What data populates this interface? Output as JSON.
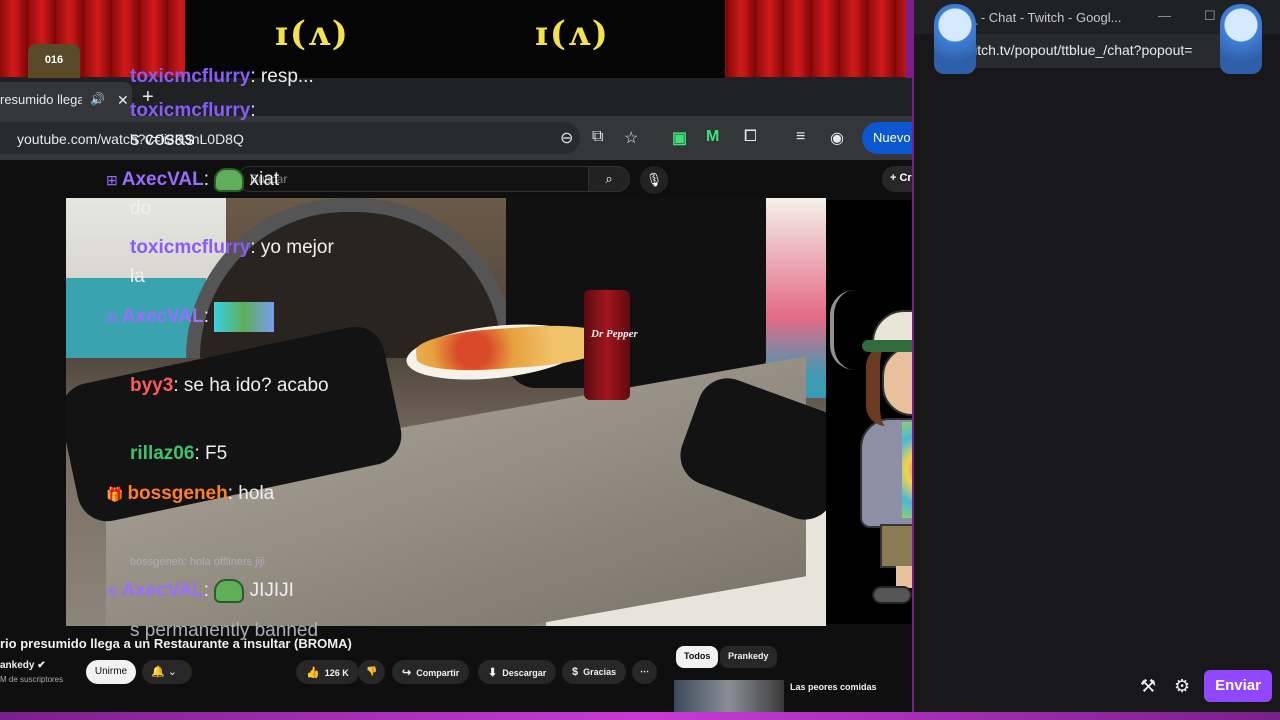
{
  "overlay": {
    "cat_badge_text": "016",
    "curtain_deco_left": "ɪ(ʌ)",
    "curtain_deco_right": "ɪ(ʌ)"
  },
  "chrome": {
    "tab_title": "resumido llega",
    "tab_audio_icon": "🔊",
    "tab_close": "✕",
    "new_tab": "+",
    "win_minimize": "—",
    "win_maximize": "☐",
    "win_close": "✕",
    "url": "youtube.com/watch?v=ii3K3nL0D8Q",
    "update_button_label": "Nuevo Chrome disponible",
    "update_menu_dots": "⋮"
  },
  "youtube": {
    "search_placeholder": "Buscar",
    "search_icon": "⌕",
    "mic_icon": "🎙",
    "create_label": "+ Crear",
    "bell_icon": "🔔",
    "avatar_icon": "☻",
    "video": {
      "can_label": "Dr Pepper"
    },
    "title": "rio presumido llega a un Restaurante a insultar (BROMA)",
    "channel_name": "ankedy ✔",
    "channel_subs": "M de suscriptores",
    "join_label": "Unirme",
    "bell_button": "🔔 ⌄",
    "like_label": "126 K",
    "like_icon": "👍",
    "dislike_icon": "👎",
    "share_label": "Compartir",
    "share_icon": "↪",
    "download_label": "Descargar",
    "download_icon": "⬇",
    "thanks_label": "Gracias",
    "thanks_icon": "$",
    "more_icon": "⋯",
    "chips": [
      "Todos",
      "Prankedy"
    ],
    "rec_title": "Las peores comidas",
    "rec_more": "⋮"
  },
  "twitch": {
    "window_title": "_ - Chat - Twitch - Googl...",
    "url": "witch.tv/popout/ttblue_/chat?popout=",
    "win_minimize": "—",
    "win_maximize": "☐",
    "win_close": "✕",
    "messages": [
      {
        "user": "toxicmcflurry",
        "sep": ":",
        "text": " resp..."
      },
      {
        "user": "toxicmcflurry",
        "sep": ":",
        "text": ""
      },
      {
        "user": "",
        "sep": "",
        "text": "s cosas"
      },
      {
        "user": "AxecVAL",
        "sep": ":",
        "text": " xiat"
      },
      {
        "user": "",
        "sep": "",
        "text": "do"
      },
      {
        "user": "toxicmcflurry",
        "sep": ":",
        "text": " yo mejor"
      },
      {
        "user": "",
        "sep": "",
        "text": "la"
      },
      {
        "user": "AxecVAL",
        "sep": ":",
        "text": ""
      },
      {
        "user": "byy3",
        "sep": ":",
        "text": " se ha ido? acabo"
      },
      {
        "user": "rillaz06",
        "sep": ":",
        "text": " F5"
      },
      {
        "user": "bossgeneh",
        "sep": ":",
        "text": " hola"
      },
      {
        "user": "AxecVAL",
        "sep": ":",
        "text": " JIJIJI"
      },
      {
        "user": "",
        "sep": "",
        "text": "s permanently banned"
      }
    ],
    "system_line": "bossgeneh: hola offliners jiji",
    "send_label": "Enviar",
    "icon_mod": "⚒",
    "icon_settings": "⚙"
  }
}
